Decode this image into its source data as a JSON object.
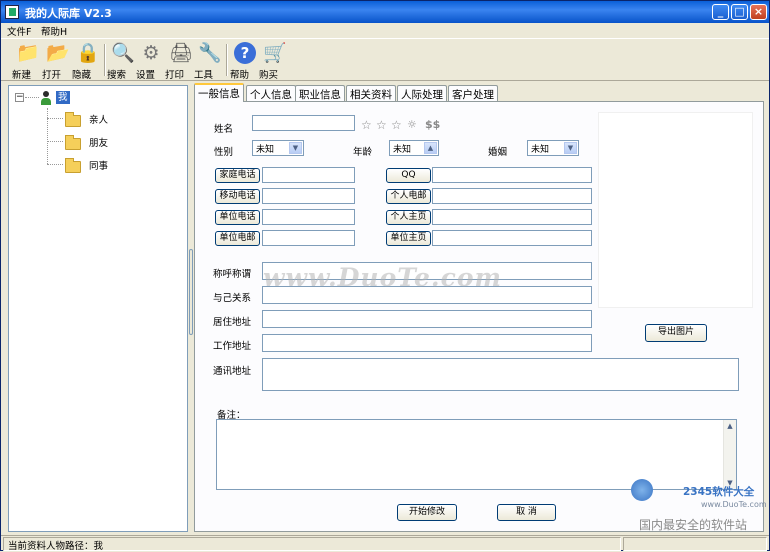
{
  "window": {
    "title": "我的人际库 V2.3",
    "min": "_",
    "max": "□",
    "close": "×"
  },
  "menu": {
    "file": "文件F",
    "help": "帮助H"
  },
  "toolbar": {
    "new": "新建",
    "open": "打开",
    "hide": "隐藏",
    "search": "搜索",
    "settings": "设置",
    "print": "打印",
    "tools": "工具",
    "help": "帮助",
    "buy": "购买"
  },
  "tree": {
    "root": "我",
    "expander": "−",
    "children": [
      "亲人",
      "朋友",
      "同事"
    ]
  },
  "tabs": [
    "一般信息",
    "个人信息",
    "职业信息",
    "相关资料",
    "人际处理",
    "客户处理"
  ],
  "form": {
    "name_label": "姓名",
    "name_value": "",
    "gender_label": "性别",
    "gender_value": "未知",
    "age_label": "年龄",
    "age_value": "未知",
    "marriage_label": "婚姻",
    "marriage_value": "未知",
    "phone_buttons": [
      "家庭电话",
      "移动电话",
      "单位电话",
      "单位电邮"
    ],
    "right_buttons": [
      "QQ",
      "个人电邮",
      "个人主页",
      "单位主页"
    ],
    "address_labels": [
      "称呼称谓",
      "与己关系",
      "居住地址",
      "工作地址",
      "通讯地址"
    ],
    "remarks_label": "备注：",
    "export_photo": "导出图片",
    "save": "开始修改",
    "cancel": "取 消"
  },
  "watermark": {
    "main": "www.DuoTe.com",
    "brand": "2345软件大全",
    "url": "www.DuoTe.com",
    "slogan": "国内最安全的软件站"
  },
  "status": {
    "path": "当前资料人物路径：我"
  }
}
